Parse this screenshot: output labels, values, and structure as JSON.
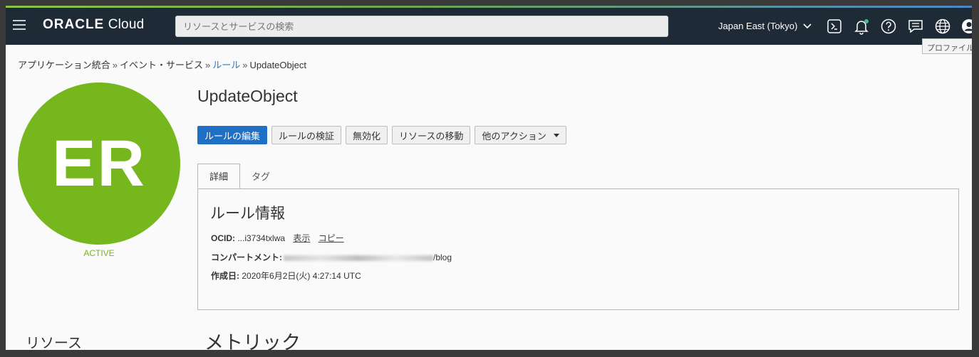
{
  "navbar": {
    "logo_brand": "ORACLE",
    "logo_product": "Cloud",
    "search_placeholder": "リソースとサービスの検索",
    "region": "Japan East (Tokyo)",
    "tooltip": "プロファイル",
    "icons": [
      "menu-icon",
      "cloud-shell-icon",
      "notification-bell-icon",
      "help-icon",
      "chat-icon",
      "globe-icon",
      "profile-icon"
    ],
    "notification_dot_color": "#3ec38e"
  },
  "breadcrumb": {
    "items": [
      {
        "label": "アプリケーション統合"
      },
      {
        "label": "イベント・サービス"
      },
      {
        "label": "ルール"
      },
      {
        "label": "UpdateObject"
      }
    ],
    "separator": "»"
  },
  "resource": {
    "initials": "ER",
    "status": "ACTIVE",
    "name": "UpdateObject",
    "avatar_color": "#76b71d"
  },
  "actions": {
    "edit": "ルールの編集",
    "validate": "ルールの検証",
    "disable": "無効化",
    "move": "リソースの移動",
    "more": "他のアクション"
  },
  "tabs": {
    "details": "詳細",
    "tags": "タグ"
  },
  "info": {
    "heading": "ルール情報",
    "ocid_label": "OCID:",
    "ocid_value": "...i3734txlwa",
    "ocid_show": "表示",
    "ocid_copy": "コピー",
    "compartment_label": "コンパートメント:",
    "compartment_suffix": "/blog",
    "created_label": "作成日:",
    "created_value": "2020年6月2日(火) 4:27:14 UTC"
  },
  "lower": {
    "resources": "リソース",
    "metrics": "メトリック"
  }
}
